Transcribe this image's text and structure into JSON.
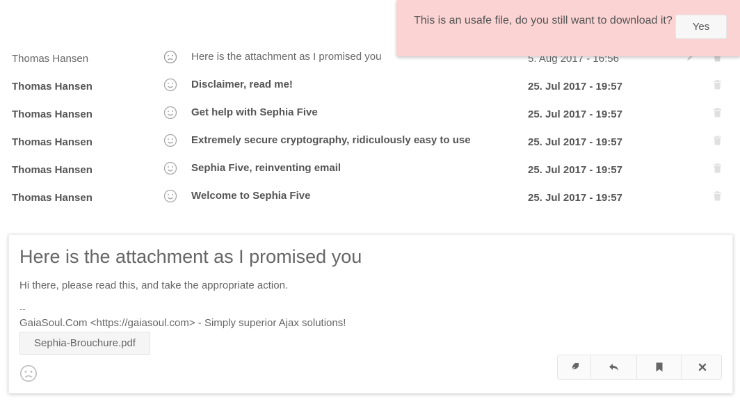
{
  "notification": {
    "message": "This is an usafe file, do you still want to download it?",
    "yes_label": "Yes",
    "color": "#fbd3d3"
  },
  "emails": [
    {
      "sender": "Thomas Hansen",
      "subject": "Here is the attachment as I promised you",
      "date": "5. Aug 2017 - 16:56",
      "mood": "sad",
      "unread": false
    },
    {
      "sender": "Thomas Hansen",
      "subject": "Disclaimer, read me!",
      "date": "25. Jul 2017 - 19:57",
      "mood": "happy",
      "unread": true
    },
    {
      "sender": "Thomas Hansen",
      "subject": "Get help with Sephia Five",
      "date": "25. Jul 2017 - 19:57",
      "mood": "happy",
      "unread": true
    },
    {
      "sender": "Thomas Hansen",
      "subject": "Extremely secure cryptography, ridiculously easy to use",
      "date": "25. Jul 2017 - 19:57",
      "mood": "happy",
      "unread": true
    },
    {
      "sender": "Thomas Hansen",
      "subject": "Sephia Five, reinventing email",
      "date": "25. Jul 2017 - 19:57",
      "mood": "happy",
      "unread": true
    },
    {
      "sender": "Thomas Hansen",
      "subject": "Welcome to Sephia Five",
      "date": "25. Jul 2017 - 19:57",
      "mood": "happy",
      "unread": true
    }
  ],
  "viewer": {
    "title": "Here is the attachment as I promised you",
    "body": "Hi there, please read this, and take the appropriate action.",
    "dash": "--",
    "signature": "GaiaSoul.Com <https://gaiasoul.com> - Simply superior Ajax solutions!",
    "attachment": "Sephia-Brouchure.pdf",
    "mood": "sad",
    "actions": [
      "forward-icon",
      "reply-icon",
      "bookmark-icon",
      "close-icon"
    ]
  }
}
